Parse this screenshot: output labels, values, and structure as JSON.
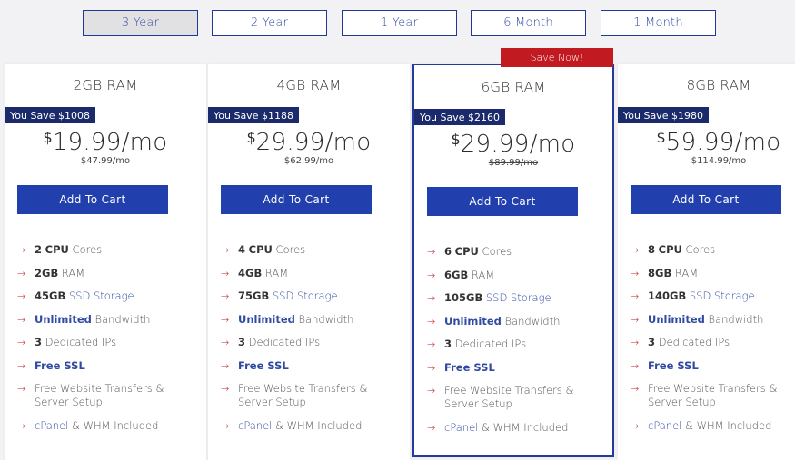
{
  "tabs": [
    "3 Year",
    "2 Year",
    "1 Year",
    "6 Month",
    "1 Month"
  ],
  "active_tab": "3 Year",
  "colors": {
    "accent": "#223fae",
    "save_badge": "#1b2a6b",
    "ribbon": "#c11a21",
    "arrow": "#c1272d"
  },
  "feature_labels": {
    "cpu": "CPU",
    "cores": "Cores",
    "ram": "RAM",
    "storage": "SSD Storage",
    "unlimited": "Unlimited",
    "bandwidth": "Bandwidth",
    "ips": "Dedicated IPs",
    "ssl": "Free SSL",
    "transfers": "Free Website Transfers & Server Setup",
    "cpanel_link": "cPanel",
    "cpanel_rest": "& WHM Included"
  },
  "plans": [
    {
      "name": "2GB RAM",
      "save": "You Save $1008",
      "dollar": "$",
      "price": "19.99/mo",
      "old_price": "$47.99/mo",
      "cta": "Add To Cart",
      "cpu": "2",
      "ram": "2GB",
      "storage": "45GB",
      "ips": "3"
    },
    {
      "name": "4GB RAM",
      "save": "You Save $1188",
      "dollar": "$",
      "price": "29.99/mo",
      "old_price": "$62.99/mo",
      "cta": "Add To Cart",
      "cpu": "4",
      "ram": "4GB",
      "storage": "75GB",
      "ips": "3"
    },
    {
      "name": "6GB RAM",
      "save": "You Save $2160",
      "dollar": "$",
      "price": "29.99/mo",
      "old_price": "$89.99/mo",
      "cta": "Add To Cart",
      "cpu": "6",
      "ram": "6GB",
      "storage": "105GB",
      "ips": "3",
      "ribbon": "Save Now!"
    },
    {
      "name": "8GB RAM",
      "save": "You Save $1980",
      "dollar": "$",
      "price": "59.99/mo",
      "old_price": "$114.99/mo",
      "cta": "Add To Cart",
      "cpu": "8",
      "ram": "8GB",
      "storage": "140GB",
      "ips": "3"
    }
  ]
}
